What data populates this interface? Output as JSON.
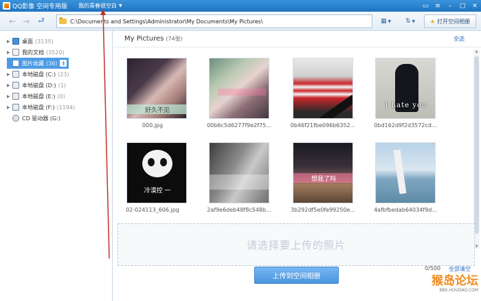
{
  "titlebar": {
    "app_title": "QQ影像 空间专用版",
    "album_selector": "我的青春很空白"
  },
  "toolbar": {
    "address": "C:\\Documents and Settings\\Administrator\\My Documents\\My Pictures\\",
    "open_album_label": "打开空间相册"
  },
  "sidebar": {
    "items": [
      {
        "label": "桌面",
        "count": "(3135)"
      },
      {
        "label": "我的文档",
        "count": "(3520)"
      },
      {
        "label": "图片收藏",
        "count": "(36)"
      },
      {
        "label": "本地磁盘 (C:)",
        "count": "(23)"
      },
      {
        "label": "本地磁盘 (D:)",
        "count": "(1)"
      },
      {
        "label": "本地磁盘 (E:)",
        "count": "(0)"
      },
      {
        "label": "本地磁盘 (F:)",
        "count": "(1194)"
      },
      {
        "label": "CD 驱动器 (G:)",
        "count": ""
      }
    ]
  },
  "main": {
    "folder_title": "My Pictures",
    "photo_count": "(74张)",
    "select_all": "全选",
    "photos": [
      {
        "name": "000.jpg",
        "overlay": "好久不见"
      },
      {
        "name": "00b6c5d6277f9e2f75...",
        "overlay": ""
      },
      {
        "name": "0b46f21fbe096b6352...",
        "overlay": ""
      },
      {
        "name": "0bd162d9f2d3572cd...",
        "overlay": "I hate you"
      },
      {
        "name": "02-024113_606.jpg",
        "overlay": "冷漠控 一"
      },
      {
        "name": "2af9e6deb48f8c548b...",
        "overlay": ""
      },
      {
        "name": "3b292df5e0fe99250e...",
        "overlay": "想我了吗"
      },
      {
        "name": "4afbfbedab64034f9d...",
        "overlay": ""
      }
    ],
    "drop_zone_text": "请选择要上传的照片",
    "upload_count": "0/500",
    "clear_all": "全部清空",
    "upload_button": "上传到空间相册"
  },
  "watermark": {
    "text": "猴岛论坛",
    "url": "BBS.HOUDAO.COM"
  },
  "colors": {
    "titlebar": "#2a82d0",
    "selection": "#4d9be6",
    "upload_button": "#5aa3e8",
    "link": "#2a6cc0"
  }
}
